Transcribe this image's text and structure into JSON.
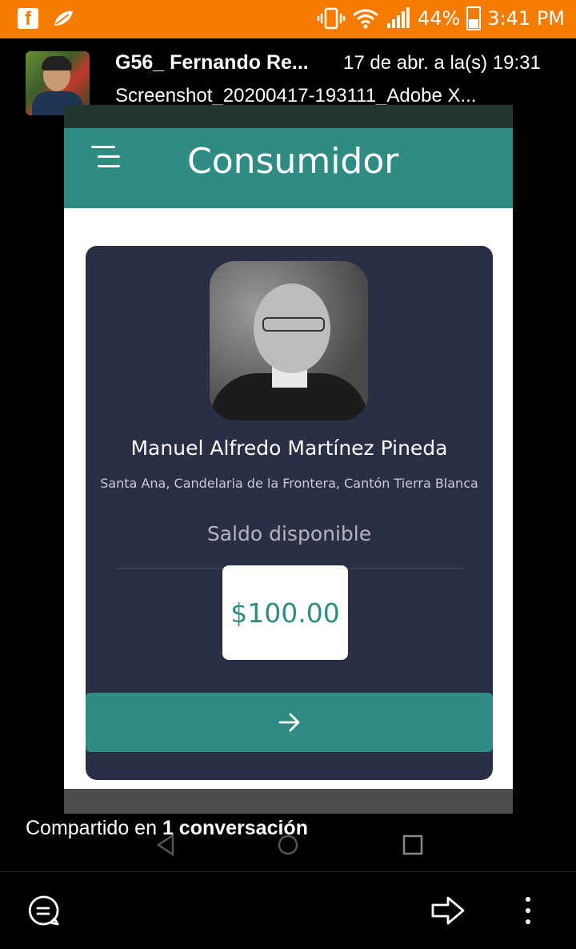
{
  "status_bar": {
    "battery": "44%",
    "time": "3:41 PM"
  },
  "message": {
    "sender": "G56_ Fernando Re...",
    "date": "17 de abr. a la(s) 19:31",
    "filename": "Screenshot_20200417-193111_Adobe X..."
  },
  "app": {
    "title": "Consumidor",
    "consumer_name": "Manuel Alfredo Martínez Pineda",
    "address": "Santa Ana, Candelaria de la Frontera, Cantón Tierra Blanca",
    "balance_label": "Saldo disponible",
    "balance_amount": "$100.00"
  },
  "footer": {
    "shared_prefix": "Compartido en ",
    "shared_bold": "1 conversación"
  },
  "colors": {
    "status_bar": "#f57c00",
    "app_bar": "#2e8c83",
    "card": "#2a2f45",
    "amount_text": "#2e8c83"
  },
  "icons": [
    "facebook-icon",
    "leaf-icon",
    "vibrate-icon",
    "wifi-icon",
    "signal-icon",
    "battery-icon",
    "menu-icon",
    "arrow-right-icon",
    "chat-icon",
    "share-icon",
    "more-vert-icon"
  ]
}
